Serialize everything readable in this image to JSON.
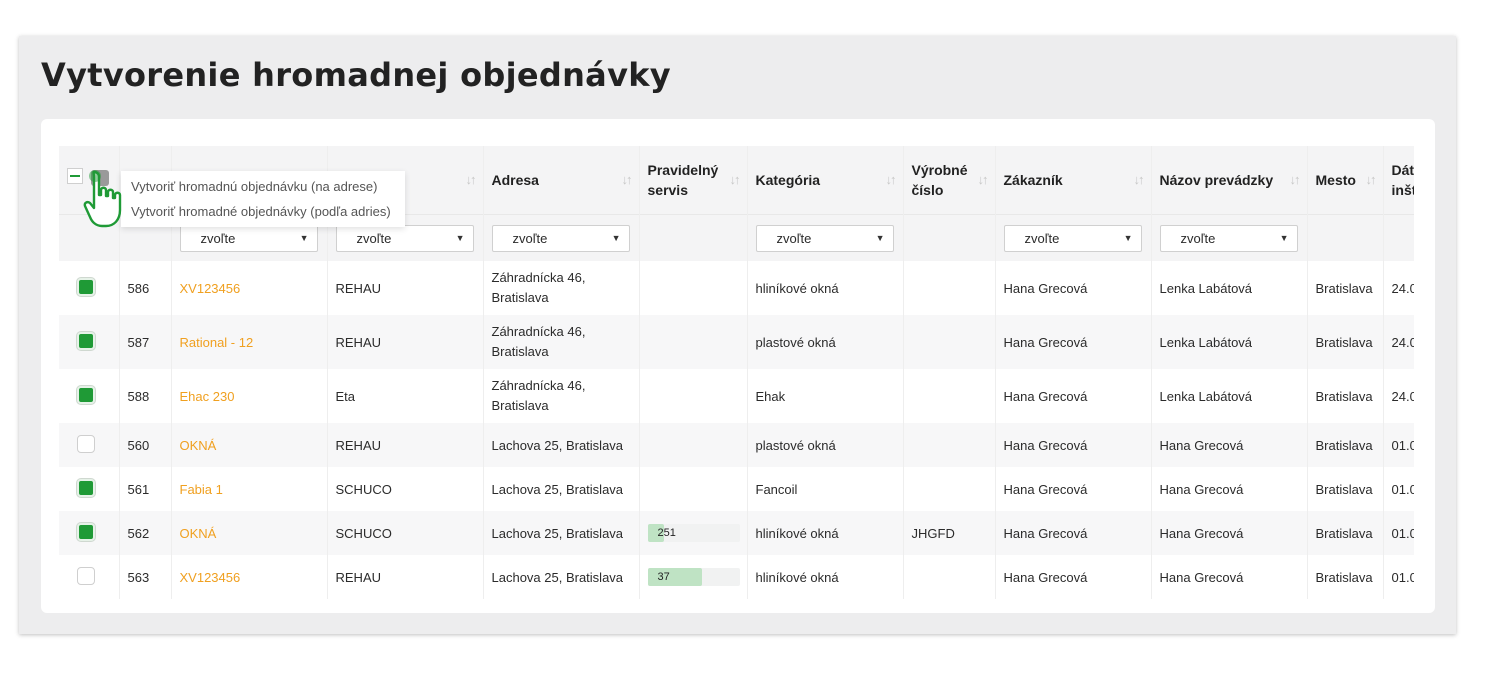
{
  "title": "Vytvorenie hromadnej objednávky",
  "bulk_menu": {
    "items": [
      "Vytvoriť hromadnú objednávku (na adrese)",
      "Vytvoriť hromadné objednávky (podľa adries)"
    ]
  },
  "columns": {
    "address": "Adresa",
    "regular_service_line1": "Pravidelný",
    "regular_service_line2": "servis",
    "category": "Kategória",
    "serial_line1": "Výrobné",
    "serial_line2": "číslo",
    "customer": "Zákazník",
    "establishment": "Názov prevádzky",
    "city": "Mesto",
    "date_line1": "Dát",
    "date_line2": "inšt"
  },
  "filter_placeholder": "zvoľte",
  "colors": {
    "accent": "#1f9a36",
    "link": "#f0a020",
    "bar": "#bfe3c4"
  },
  "rows": [
    {
      "checked": true,
      "id": "586",
      "name": "XV123456",
      "brand": "REHAU",
      "address_line1": "Záhradnícka 46,",
      "address_line2": "Bratislava",
      "service": "",
      "service_pct": 0,
      "category": "hliníkové okná",
      "serial": "",
      "customer": "Hana Grecová",
      "establishment": "Lenka Labátová",
      "city": "Bratislava",
      "date": "24.0"
    },
    {
      "checked": true,
      "id": "587",
      "name": "Rational - 12",
      "brand": "REHAU",
      "address_line1": "Záhradnícka 46,",
      "address_line2": "Bratislava",
      "service": "",
      "service_pct": 0,
      "category": "plastové okná",
      "serial": "",
      "customer": "Hana Grecová",
      "establishment": "Lenka Labátová",
      "city": "Bratislava",
      "date": "24.0"
    },
    {
      "checked": true,
      "id": "588",
      "name": "Ehac 230",
      "brand": "Eta",
      "address_line1": "Záhradnícka 46,",
      "address_line2": "Bratislava",
      "service": "",
      "service_pct": 0,
      "category": "Ehak",
      "serial": "",
      "customer": "Hana Grecová",
      "establishment": "Lenka Labátová",
      "city": "Bratislava",
      "date": "24.0"
    },
    {
      "checked": false,
      "id": "560",
      "name": "OKNÁ",
      "brand": "REHAU",
      "address_line1": "Lachova 25, Bratislava",
      "address_line2": "",
      "service": "",
      "service_pct": 0,
      "category": "plastové okná",
      "serial": "",
      "customer": "Hana Grecová",
      "establishment": "Hana Grecová",
      "city": "Bratislava",
      "date": "01.0"
    },
    {
      "checked": true,
      "id": "561",
      "name": "Fabia 1",
      "brand": "SCHUCO",
      "address_line1": "Lachova 25, Bratislava",
      "address_line2": "",
      "service": "",
      "service_pct": 0,
      "category": "Fancoil",
      "serial": "",
      "customer": "Hana Grecová",
      "establishment": "Hana Grecová",
      "city": "Bratislava",
      "date": "01.0"
    },
    {
      "checked": true,
      "id": "562",
      "name": "OKNÁ",
      "brand": "SCHUCO",
      "address_line1": "Lachova 25, Bratislava",
      "address_line2": "",
      "service": "251",
      "service_pct": 18,
      "category": "hliníkové okná",
      "serial": "JHGFD",
      "customer": "Hana Grecová",
      "establishment": "Hana Grecová",
      "city": "Bratislava",
      "date": "01.0"
    },
    {
      "checked": false,
      "id": "563",
      "name": "XV123456",
      "brand": "REHAU",
      "address_line1": "Lachova 25, Bratislava",
      "address_line2": "",
      "service": "37",
      "service_pct": 59,
      "category": "hliníkové okná",
      "serial": "",
      "customer": "Hana Grecová",
      "establishment": "Hana Grecová",
      "city": "Bratislava",
      "date": "01.0"
    }
  ]
}
